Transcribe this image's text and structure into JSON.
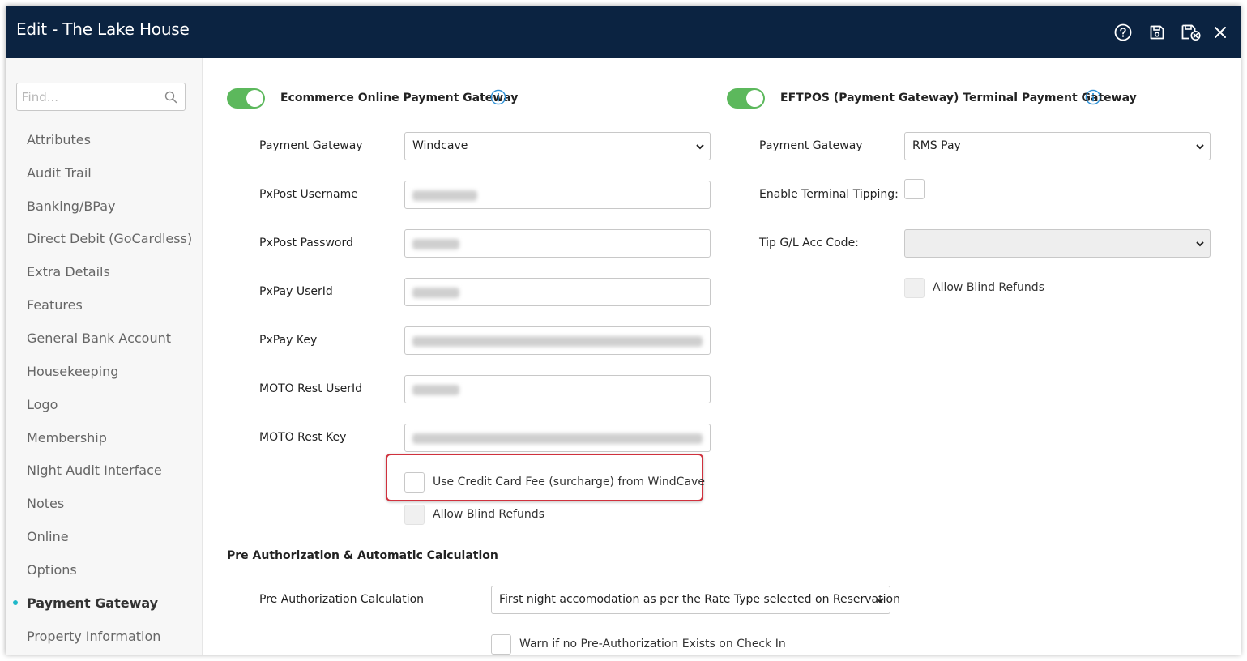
{
  "window": {
    "title": "Edit - The Lake House"
  },
  "toolbar": {
    "help_icon": "question-circle-icon",
    "save_icon": "floppy-disk-icon",
    "save_close_icon": "save-close-icon",
    "close_icon": "close-icon"
  },
  "sidebar": {
    "search": {
      "placeholder": "Find...",
      "icon": "search-icon"
    },
    "items": [
      {
        "label": "Attributes"
      },
      {
        "label": "Audit Trail"
      },
      {
        "label": "Banking/BPay"
      },
      {
        "label": "Direct Debit (GoCardless)"
      },
      {
        "label": "Extra Details"
      },
      {
        "label": "Features"
      },
      {
        "label": "General Bank Account"
      },
      {
        "label": "Housekeeping"
      },
      {
        "label": "Logo"
      },
      {
        "label": "Membership"
      },
      {
        "label": "Night Audit Interface"
      },
      {
        "label": "Notes"
      },
      {
        "label": "Online"
      },
      {
        "label": "Options"
      },
      {
        "label": "Payment Gateway",
        "active": true
      },
      {
        "label": "Property Information"
      }
    ]
  },
  "ecommerce": {
    "title": "Ecommerce Online Payment Gateway",
    "enabled": true,
    "payment_gateway": {
      "label": "Payment Gateway",
      "value": "Windcave"
    },
    "pxpost_username": {
      "label": "PxPost Username"
    },
    "pxpost_password": {
      "label": "PxPost Password"
    },
    "pxpay_userid": {
      "label": "PxPay UserId"
    },
    "pxpay_key": {
      "label": "PxPay Key"
    },
    "moto_rest_userid": {
      "label": "MOTO Rest UserId"
    },
    "moto_rest_key": {
      "label": "MOTO Rest Key"
    },
    "use_cc_fee": {
      "label": "Use Credit Card Fee (surcharge) from WindCave",
      "checked": false
    },
    "allow_blind_refunds": {
      "label": "Allow Blind Refunds",
      "checked": false,
      "disabled": true
    }
  },
  "eftpos": {
    "title": "EFTPOS (Payment Gateway) Terminal Payment Gateway",
    "enabled": true,
    "payment_gateway": {
      "label": "Payment Gateway",
      "value": "RMS Pay"
    },
    "enable_tipping": {
      "label": "Enable Terminal Tipping:",
      "checked": false
    },
    "tip_gl_code": {
      "label": "Tip G/L Acc Code:",
      "value": ""
    },
    "allow_blind_refunds": {
      "label": "Allow Blind Refunds",
      "checked": false,
      "disabled": true
    }
  },
  "preauth": {
    "title": "Pre Authorization & Automatic Calculation",
    "calculation": {
      "label": "Pre Authorization Calculation",
      "value": "First night accomodation as per the Rate Type selected on Reservation"
    },
    "warn": {
      "label": "Warn if no Pre-Authorization Exists on Check In",
      "checked": false
    }
  }
}
